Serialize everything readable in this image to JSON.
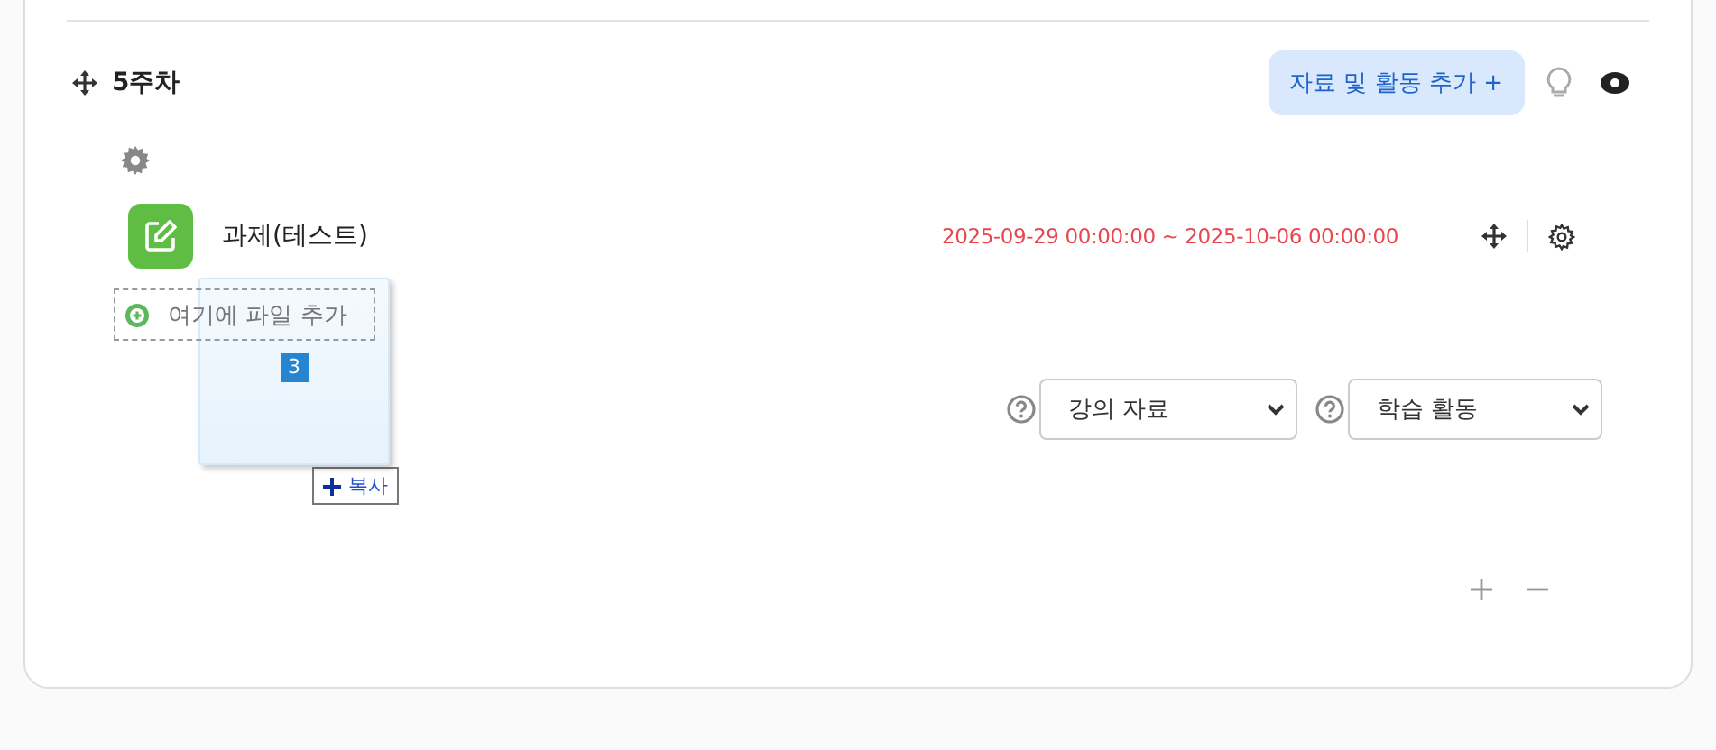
{
  "section": {
    "title": "5주차",
    "add_button": "자료 및 활동 추가 +"
  },
  "activity": {
    "name": "과제(테스트)",
    "dates": "2025-09-29 00:00:00 ~ 2025-10-06 00:00:00"
  },
  "dropzone": {
    "label": "여기에 파일 추가"
  },
  "drag": {
    "count": "3",
    "action": "복사"
  },
  "selects": [
    {
      "value": "강의 자료"
    },
    {
      "value": "학습 활동"
    }
  ]
}
